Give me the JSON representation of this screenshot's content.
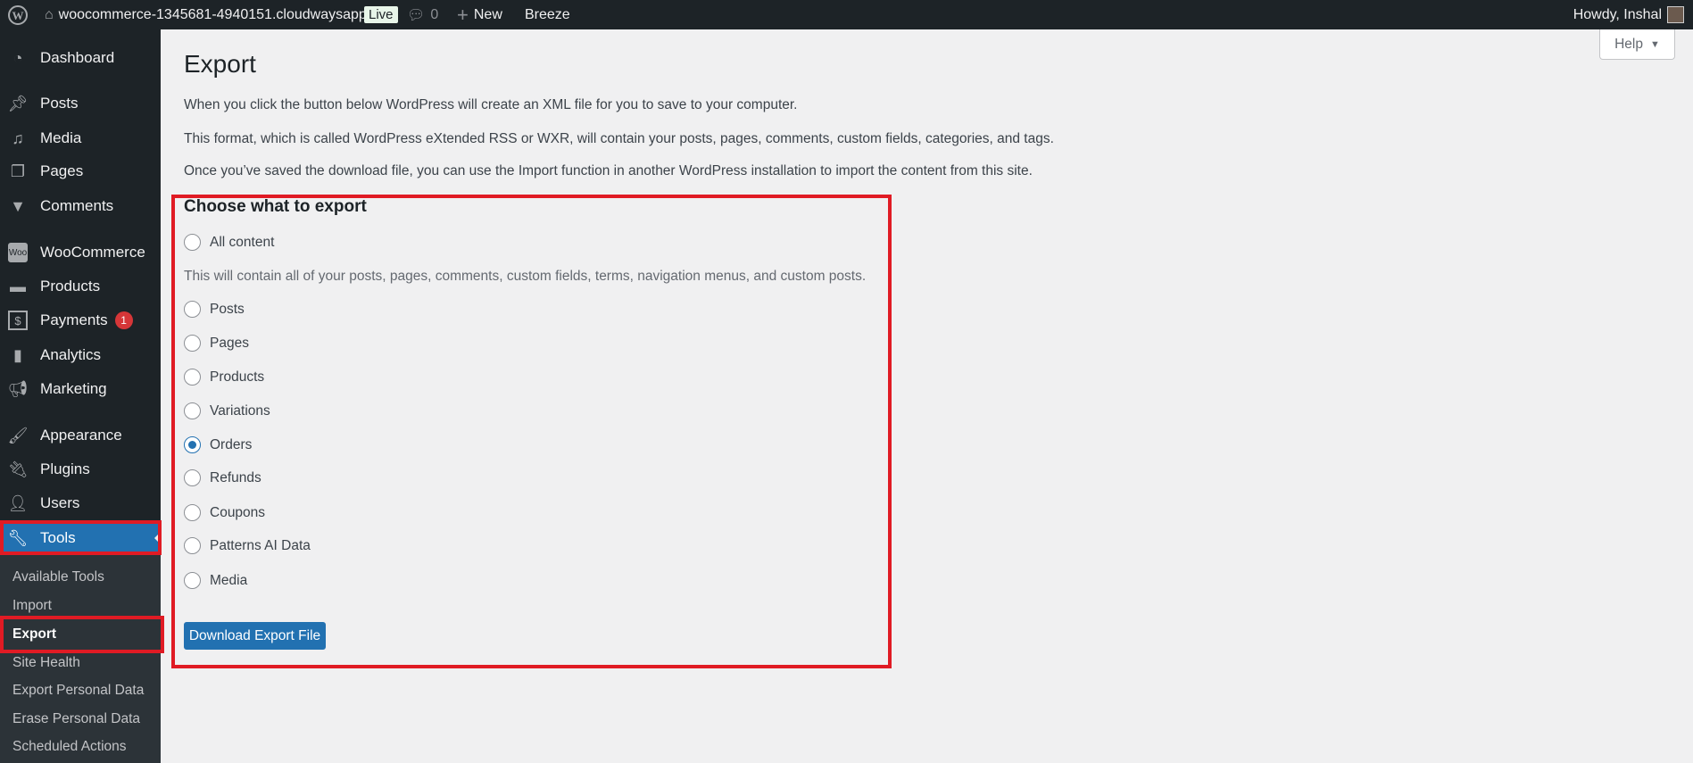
{
  "topbar": {
    "site": "woocommerce-1345681-4940151.cloudwaysapp...",
    "live": "Live",
    "comments": "0",
    "new": "New",
    "breeze": "Breeze",
    "howdy": "Howdy, Inshal"
  },
  "sidebar": {
    "items": [
      {
        "label": "Dashboard",
        "icon": "dashboard-icon"
      },
      {
        "label": "Posts",
        "icon": "pin-icon"
      },
      {
        "label": "Media",
        "icon": "media-icon"
      },
      {
        "label": "Pages",
        "icon": "pages-icon"
      },
      {
        "label": "Comments",
        "icon": "comment-icon"
      },
      {
        "label": "WooCommerce",
        "icon": "woo-icon"
      },
      {
        "label": "Products",
        "icon": "archive-icon"
      },
      {
        "label": "Payments",
        "icon": "dollar-icon",
        "badge": "1"
      },
      {
        "label": "Analytics",
        "icon": "chart-icon"
      },
      {
        "label": "Marketing",
        "icon": "megaphone-icon"
      },
      {
        "label": "Appearance",
        "icon": "brush-icon"
      },
      {
        "label": "Plugins",
        "icon": "plugin-icon"
      },
      {
        "label": "Users",
        "icon": "user-icon"
      },
      {
        "label": "Tools",
        "icon": "wrench-icon"
      }
    ],
    "submenu": [
      "Available Tools",
      "Import",
      "Export",
      "Site Health",
      "Export Personal Data",
      "Erase Personal Data",
      "Scheduled Actions"
    ]
  },
  "help": "Help",
  "main": {
    "title": "Export",
    "paragraphs": [
      "When you click the button below WordPress will create an XML file for you to save to your computer.",
      "This format, which is called WordPress eXtended RSS or WXR, will contain your posts, pages, comments, custom fields, categories, and tags.",
      "Once you’ve saved the download file, you can use the Import function in another WordPress installation to import the content from this site."
    ],
    "heading": "Choose what to export",
    "all_content": "All content",
    "all_desc": "This will contain all of your posts, pages, comments, custom fields, terms, navigation menus, and custom posts.",
    "options": [
      "Posts",
      "Pages",
      "Products",
      "Variations",
      "Orders",
      "Refunds",
      "Coupons",
      "Patterns AI Data",
      "Media"
    ],
    "selected": "Orders",
    "button": "Download Export File"
  }
}
